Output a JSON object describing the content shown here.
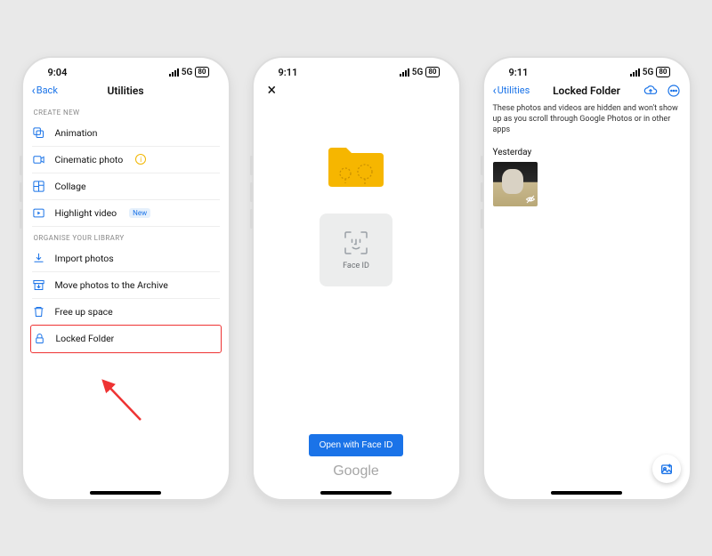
{
  "status": {
    "time1": "9:04",
    "time2": "9:11",
    "time3": "9:11",
    "net": "5G",
    "batt": "80"
  },
  "p1": {
    "back": "Back",
    "title": "Utilities",
    "sec1": "CREATE NEW",
    "rows1": {
      "animation": "Animation",
      "cinematic": "Cinematic photo",
      "collage": "Collage",
      "highlight": "Highlight video",
      "new_badge": "New"
    },
    "sec2": "ORGANISE YOUR LIBRARY",
    "rows2": {
      "import": "Import photos",
      "archive": "Move photos to the Archive",
      "freeup": "Free up space",
      "locked": "Locked Folder"
    }
  },
  "p2": {
    "faceid_label": "Face ID",
    "open_btn": "Open with Face ID",
    "brand": "Google"
  },
  "p3": {
    "back": "Utilities",
    "title": "Locked Folder",
    "desc": "These photos and videos are hidden and won't show up as you scroll through Google Photos or in other apps",
    "day": "Yesterday"
  }
}
